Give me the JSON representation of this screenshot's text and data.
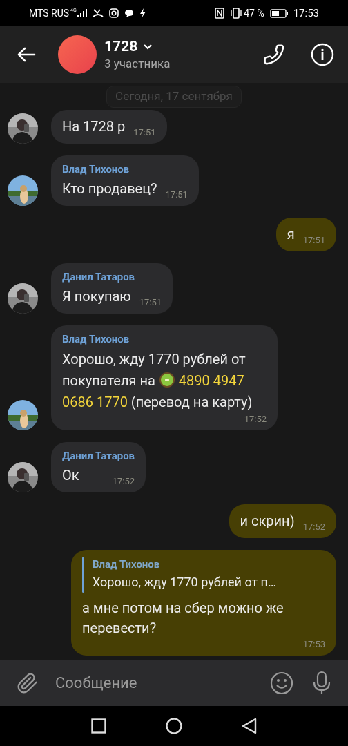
{
  "status_bar": {
    "carrier": "MTS RUS",
    "network": "4G",
    "battery": "47 %",
    "time": "17:53"
  },
  "header": {
    "title": "1728",
    "subtitle": "3 участника"
  },
  "date_label": "Сегодня, 17 сентября",
  "messages": [
    {
      "kind": "in",
      "text": "На 1728 р",
      "time": "17:51"
    },
    {
      "kind": "in",
      "sender": "Влад Тихонов",
      "text": "Кто продавец?",
      "time": "17:51"
    },
    {
      "kind": "out",
      "text": "я",
      "time": "17:51"
    },
    {
      "kind": "in",
      "sender": "Данил Татаров",
      "text": "Я покупаю",
      "time": "17:51"
    },
    {
      "kind": "in",
      "sender": "Влад Тихонов",
      "segments": [
        {
          "kind": "plain",
          "text": "Хорошо, жду 1770 рублей от покупателя на "
        },
        {
          "kind": "kiwi"
        },
        {
          "kind": "highlight",
          "text": " 4890 4947 0686 1770"
        },
        {
          "kind": "plain",
          "text": " (перевод на карту)"
        }
      ],
      "time": "17:52"
    },
    {
      "kind": "in",
      "sender": "Данил Татаров",
      "text": "Ок",
      "time": "17:52"
    },
    {
      "kind": "out",
      "text": "и скрин)",
      "time": "17:52"
    },
    {
      "kind": "out",
      "reply": {
        "sender": "Влад Тихонов",
        "text": "Хорошо, жду 1770 рублей от п…"
      },
      "text": "а мне потом на сбер можно же перевести?",
      "time": "17:53"
    }
  ],
  "composer": {
    "placeholder": "Сообщение"
  }
}
